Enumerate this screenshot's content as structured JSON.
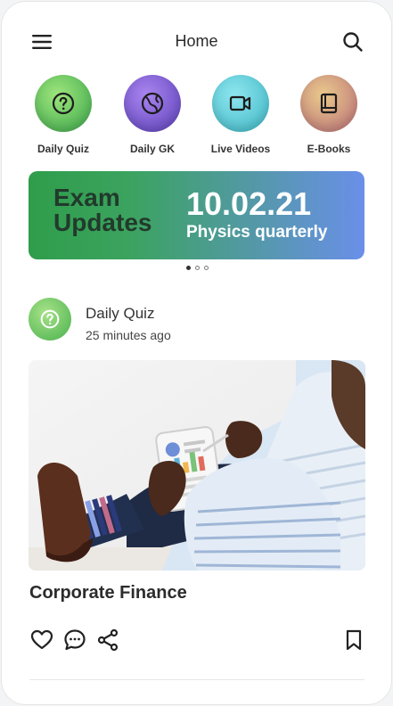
{
  "header": {
    "title": "Home"
  },
  "quick_links": [
    {
      "label": "Daily Quiz",
      "icon": "question-icon",
      "color_from": "#9ee57c",
      "color_to": "#39a64a"
    },
    {
      "label": "Daily GK",
      "icon": "globe-icon",
      "color_from": "#a985ef",
      "color_to": "#5b3fb8"
    },
    {
      "label": "Live Videos",
      "icon": "video-camera-icon",
      "color_from": "#8ee6ef",
      "color_to": "#3cb5c3"
    },
    {
      "label": "E-Books",
      "icon": "book-icon",
      "color_from": "#e9c98b",
      "color_to": "#b96d77"
    }
  ],
  "banner": {
    "line1": "Exam",
    "line2": "Updates",
    "date": "10.02.21",
    "subtitle": "Physics quarterly",
    "active_index": 0,
    "total": 3
  },
  "post": {
    "category": "Daily Quiz",
    "time": "25 minutes ago",
    "headline": "Corporate Finance"
  },
  "colors": {
    "accent_green": "#3aa34f",
    "text_dark": "#222222"
  }
}
